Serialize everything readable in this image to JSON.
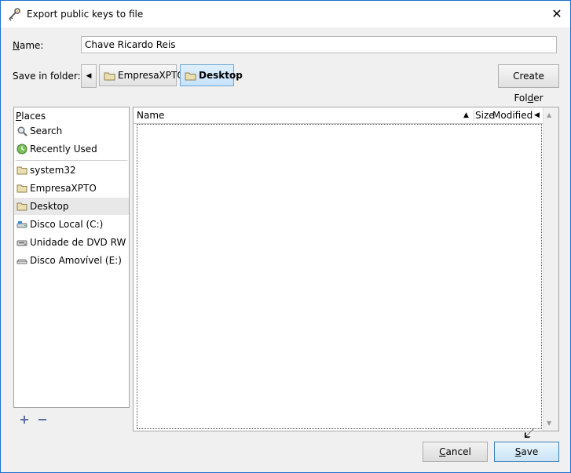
{
  "window": {
    "title": "Export public keys to file",
    "close_glyph": "✕",
    "icon": "key-icon"
  },
  "name_field": {
    "label_accel": "N",
    "label_rest": "ame:",
    "value": "Chave Ricardo Reis"
  },
  "folder_path": {
    "label": "Save in folder:",
    "back_glyph": "◀",
    "crumbs": [
      "EmpresaXPTO",
      "Desktop"
    ],
    "active_index": 1
  },
  "create_folder": {
    "label_pre": "Create Fol",
    "label_accel": "d",
    "label_post": "er"
  },
  "places": {
    "header_accel": "P",
    "header_rest": "laces",
    "items": [
      {
        "label": "Search",
        "icon": "search-icon"
      },
      {
        "label": "Recently Used",
        "icon": "recent-icon"
      },
      {
        "label": "system32",
        "icon": "folder-icon"
      },
      {
        "label": "EmpresaXPTO",
        "icon": "folder-icon"
      },
      {
        "label": "Desktop",
        "icon": "folder-icon",
        "selected": true
      },
      {
        "label": "Disco Local (C:)",
        "icon": "drive-icon"
      },
      {
        "label": "Unidade de DVD RW ...",
        "icon": "dvd-drive-icon"
      },
      {
        "label": "Disco Amovível (E:)",
        "icon": "removable-drive-icon"
      }
    ],
    "add_icon": "plus-icon",
    "remove_icon": "minus-icon"
  },
  "file_list": {
    "columns": [
      "Name",
      "Size",
      "Modified"
    ],
    "sort_glyph": "▲",
    "more_glyph": "◀",
    "rows": []
  },
  "buttons": {
    "cancel_accel": "C",
    "cancel_rest": "ancel",
    "save_accel": "S",
    "save_rest": "ave"
  },
  "colors": {
    "accent": "#1e6fd0",
    "selection": "#c6e2fb",
    "folder": "#c8b56a"
  }
}
